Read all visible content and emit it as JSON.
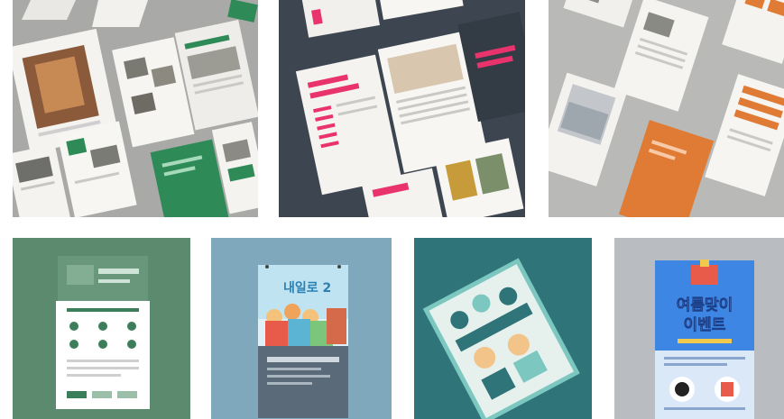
{
  "gallery": {
    "tiles": [
      {
        "id": "green-brochure",
        "bg": "#a9aaa8",
        "accent": "#2e8b57"
      },
      {
        "id": "navy-magazine",
        "bg": "#3d4650",
        "accent": "#e8336d"
      },
      {
        "id": "orange-brochure",
        "bg": "#b9bab8",
        "accent": "#e07b35"
      },
      {
        "id": "green-poster",
        "bg": "#5b8a6e",
        "accent": "#3c7d5a"
      },
      {
        "id": "cartoon-poster",
        "bg": "#7fa8bd",
        "accent": "#5bb4d4",
        "headline": "내일로 2"
      },
      {
        "id": "teal-flyer",
        "bg": "#2f7478",
        "accent": "#7cc7c0"
      },
      {
        "id": "event-poster",
        "bg": "#b9bdc2",
        "accent": "#2f6fd0",
        "headline_line1": "여름맞이",
        "headline_line2": "이벤트"
      }
    ]
  }
}
